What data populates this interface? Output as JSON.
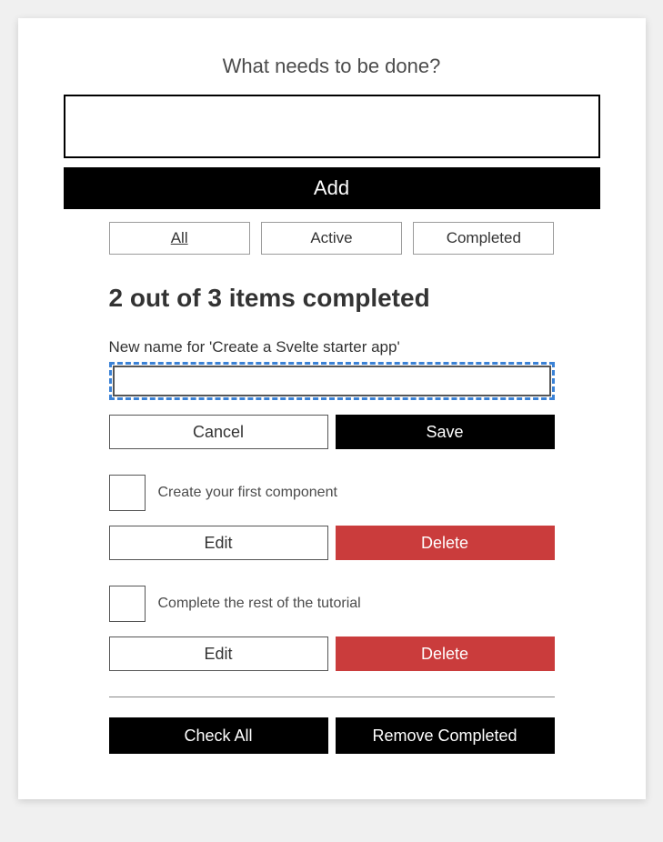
{
  "form": {
    "label": "What needs to be done?",
    "add_button": "Add"
  },
  "filters": {
    "all": "All",
    "active": "Active",
    "completed": "Completed"
  },
  "status_heading": "2 out of 3 items completed",
  "editing": {
    "label": "New name for 'Create a Svelte starter app'",
    "value": "",
    "cancel": "Cancel",
    "save": "Save"
  },
  "todos": [
    {
      "label": "Create your first component",
      "edit": "Edit",
      "delete": "Delete"
    },
    {
      "label": "Complete the rest of the tutorial",
      "edit": "Edit",
      "delete": "Delete"
    }
  ],
  "footer": {
    "check_all": "Check All",
    "remove_completed": "Remove Completed"
  }
}
